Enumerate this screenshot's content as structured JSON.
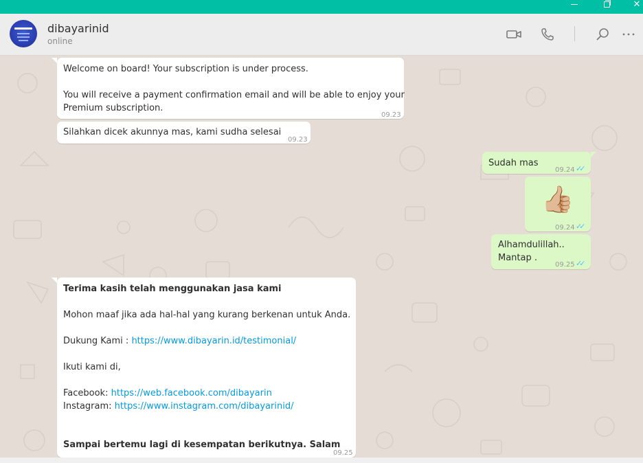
{
  "window": {
    "close_glyph": "✕"
  },
  "header": {
    "contact_name": "dibayarinid",
    "status": "online",
    "icons": [
      "video-call-icon",
      "voice-call-icon",
      "search-icon",
      "more-options-icon"
    ],
    "more_glyph": "⋯"
  },
  "messages": [
    {
      "direction": "incoming",
      "lines": [
        "Welcome on board! Your subscription is under process.",
        "You will receive a payment confirmation email and will be able to enjoy your",
        "Premium subscription."
      ],
      "time": "09.23"
    },
    {
      "direction": "incoming",
      "text": "Silahkan dicek akunnya mas, kami sudha selesai",
      "time": "09.23"
    },
    {
      "direction": "outgoing",
      "text": "Sudah mas",
      "time": "09.24",
      "status": "read"
    },
    {
      "direction": "outgoing",
      "emoji": "👍🏼",
      "emoji_name": "thumbs-up-emoji",
      "time": "09.24",
      "status": "read"
    },
    {
      "direction": "outgoing",
      "lines": [
        "Alhamdulillah..",
        "Mantap ."
      ],
      "time": "09.25",
      "status": "read"
    },
    {
      "direction": "incoming",
      "heading": "Terima kasih telah menggunakan jasa kami",
      "apology": "Mohon maaf jika ada hal-hal yang kurang berkenan untuk Anda.",
      "support_label": "Dukung Kami : ",
      "support_link": "https://www.dibayarin.id/testimonial/",
      "follow": "Ikuti kami di,",
      "facebook_label": "Facebook: ",
      "facebook_link": "https://web.facebook.com/dibayarin",
      "instagram_label": "Instagram: ",
      "instagram_link": "https://www.instagram.com/dibayarinid/",
      "closing": "Sampai bertemu lagi di kesempatan berikutnya. Salam",
      "time": "09.25"
    }
  ],
  "colors": {
    "accent": "#00bfa5",
    "outgoing_bubble": "#dcf8c6",
    "incoming_bubble": "#ffffff",
    "chat_background": "#e5ddd5",
    "link": "#039be5",
    "read_ticks": "#4fc3f7"
  }
}
